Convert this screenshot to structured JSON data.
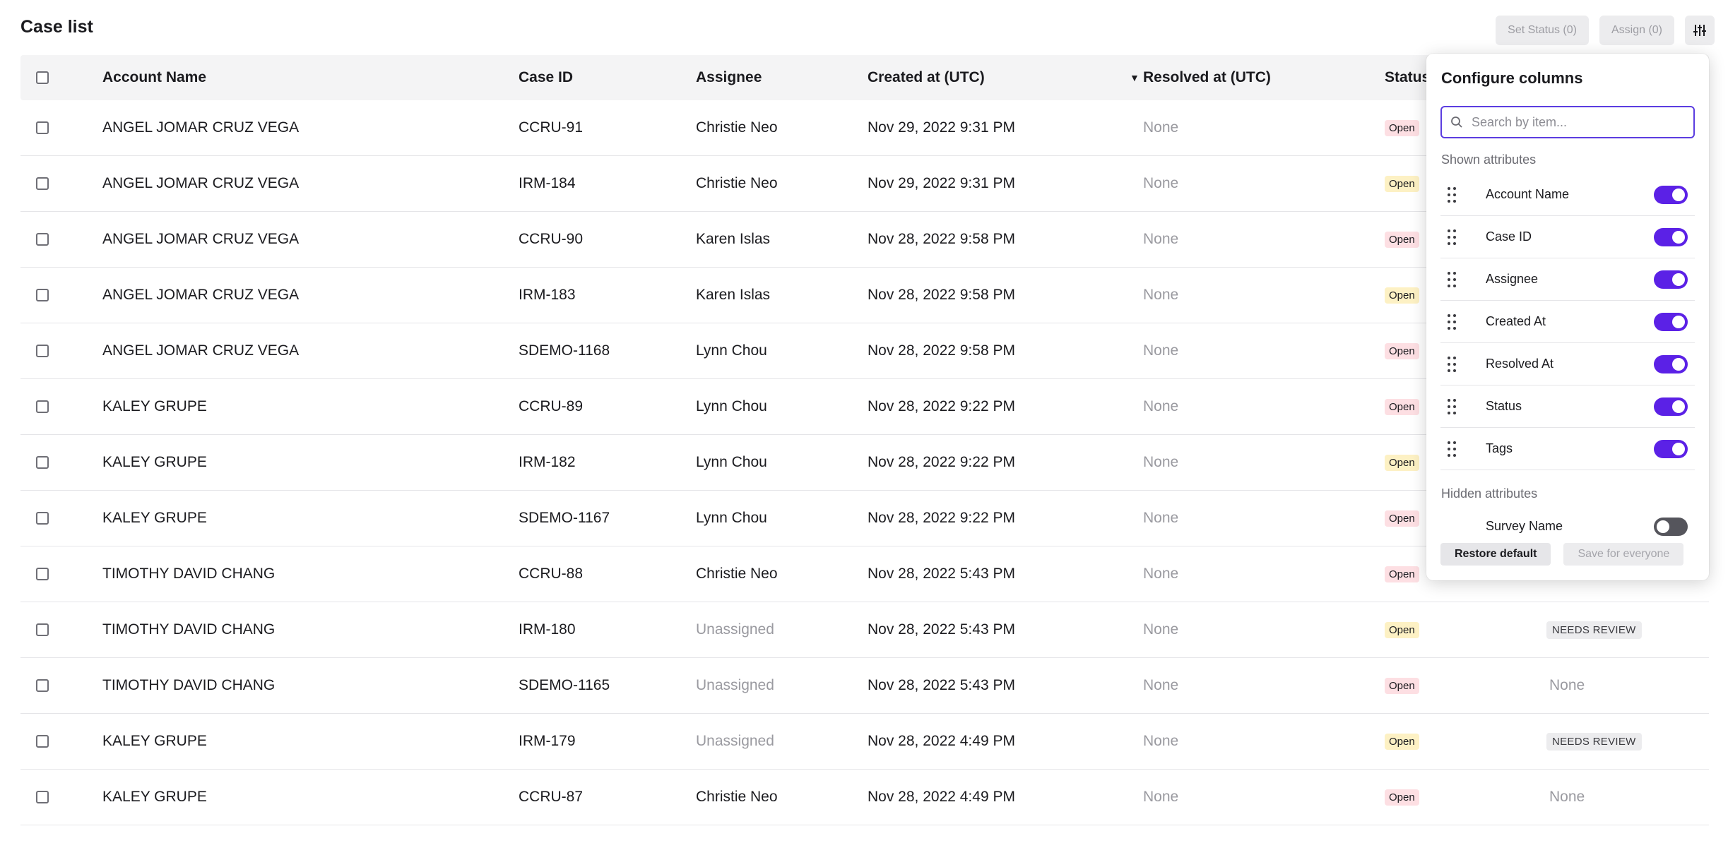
{
  "page": {
    "title": "Case list"
  },
  "toolbar": {
    "set_status_label": "Set Status (0)",
    "assign_label": "Assign (0)",
    "configure_icon": "sliders-icon"
  },
  "table": {
    "columns": {
      "account_name": "Account Name",
      "case_id": "Case ID",
      "assignee": "Assignee",
      "created_at": "Created at (UTC)",
      "resolved_at": "Resolved at (UTC)",
      "status": "Status"
    },
    "rows": [
      {
        "account": "ANGEL JOMAR CRUZ VEGA",
        "case_id": "CCRU-91",
        "assignee": "Christie Neo",
        "created": "Nov 29, 2022 9:31 PM",
        "resolved": "None",
        "status": "Open",
        "status_color": "pink",
        "tag": ""
      },
      {
        "account": "ANGEL JOMAR CRUZ VEGA",
        "case_id": "IRM-184",
        "assignee": "Christie Neo",
        "created": "Nov 29, 2022 9:31 PM",
        "resolved": "None",
        "status": "Open",
        "status_color": "yellow",
        "tag": ""
      },
      {
        "account": "ANGEL JOMAR CRUZ VEGA",
        "case_id": "CCRU-90",
        "assignee": "Karen Islas",
        "created": "Nov 28, 2022 9:58 PM",
        "resolved": "None",
        "status": "Open",
        "status_color": "pink",
        "tag": ""
      },
      {
        "account": "ANGEL JOMAR CRUZ VEGA",
        "case_id": "IRM-183",
        "assignee": "Karen Islas",
        "created": "Nov 28, 2022 9:58 PM",
        "resolved": "None",
        "status": "Open",
        "status_color": "yellow",
        "tag": ""
      },
      {
        "account": "ANGEL JOMAR CRUZ VEGA",
        "case_id": "SDEMO-1168",
        "assignee": "Lynn Chou",
        "created": "Nov 28, 2022 9:58 PM",
        "resolved": "None",
        "status": "Open",
        "status_color": "pink",
        "tag": ""
      },
      {
        "account": "KALEY GRUPE",
        "case_id": "CCRU-89",
        "assignee": "Lynn Chou",
        "created": "Nov 28, 2022 9:22 PM",
        "resolved": "None",
        "status": "Open",
        "status_color": "pink",
        "tag": ""
      },
      {
        "account": "KALEY GRUPE",
        "case_id": "IRM-182",
        "assignee": "Lynn Chou",
        "created": "Nov 28, 2022 9:22 PM",
        "resolved": "None",
        "status": "Open",
        "status_color": "yellow",
        "tag": ""
      },
      {
        "account": "KALEY GRUPE",
        "case_id": "SDEMO-1167",
        "assignee": "Lynn Chou",
        "created": "Nov 28, 2022 9:22 PM",
        "resolved": "None",
        "status": "Open",
        "status_color": "pink",
        "tag": ""
      },
      {
        "account": "TIMOTHY DAVID CHANG",
        "case_id": "CCRU-88",
        "assignee": "Christie Neo",
        "created": "Nov 28, 2022 5:43 PM",
        "resolved": "None",
        "status": "Open",
        "status_color": "pink",
        "tag": ""
      },
      {
        "account": "TIMOTHY DAVID CHANG",
        "case_id": "IRM-180",
        "assignee": "Unassigned",
        "created": "Nov 28, 2022 5:43 PM",
        "resolved": "None",
        "status": "Open",
        "status_color": "yellow",
        "tag": "NEEDS REVIEW"
      },
      {
        "account": "TIMOTHY DAVID CHANG",
        "case_id": "SDEMO-1165",
        "assignee": "Unassigned",
        "created": "Nov 28, 2022 5:43 PM",
        "resolved": "None",
        "status": "Open",
        "status_color": "pink",
        "tag": "None"
      },
      {
        "account": "KALEY GRUPE",
        "case_id": "IRM-179",
        "assignee": "Unassigned",
        "created": "Nov 28, 2022 4:49 PM",
        "resolved": "None",
        "status": "Open",
        "status_color": "yellow",
        "tag": "NEEDS REVIEW"
      },
      {
        "account": "KALEY GRUPE",
        "case_id": "CCRU-87",
        "assignee": "Christie Neo",
        "created": "Nov 28, 2022 4:49 PM",
        "resolved": "None",
        "status": "Open",
        "status_color": "pink",
        "tag": "None"
      }
    ]
  },
  "configure": {
    "title": "Configure columns",
    "search_placeholder": "Search by item...",
    "shown_label": "Shown attributes",
    "shown": [
      {
        "label": "Account Name",
        "on": true
      },
      {
        "label": "Case ID",
        "on": true
      },
      {
        "label": "Assignee",
        "on": true
      },
      {
        "label": "Created At",
        "on": true
      },
      {
        "label": "Resolved At",
        "on": true
      },
      {
        "label": "Status",
        "on": true
      },
      {
        "label": "Tags",
        "on": true
      }
    ],
    "hidden_label": "Hidden attributes",
    "hidden": [
      {
        "label": "Survey Name",
        "on": false
      }
    ],
    "restore_label": "Restore default",
    "save_label": "Save for everyone"
  },
  "colors": {
    "accent": "#5b21e6",
    "status_pink": "#fddfe3",
    "status_yellow": "#fdf1c4"
  }
}
